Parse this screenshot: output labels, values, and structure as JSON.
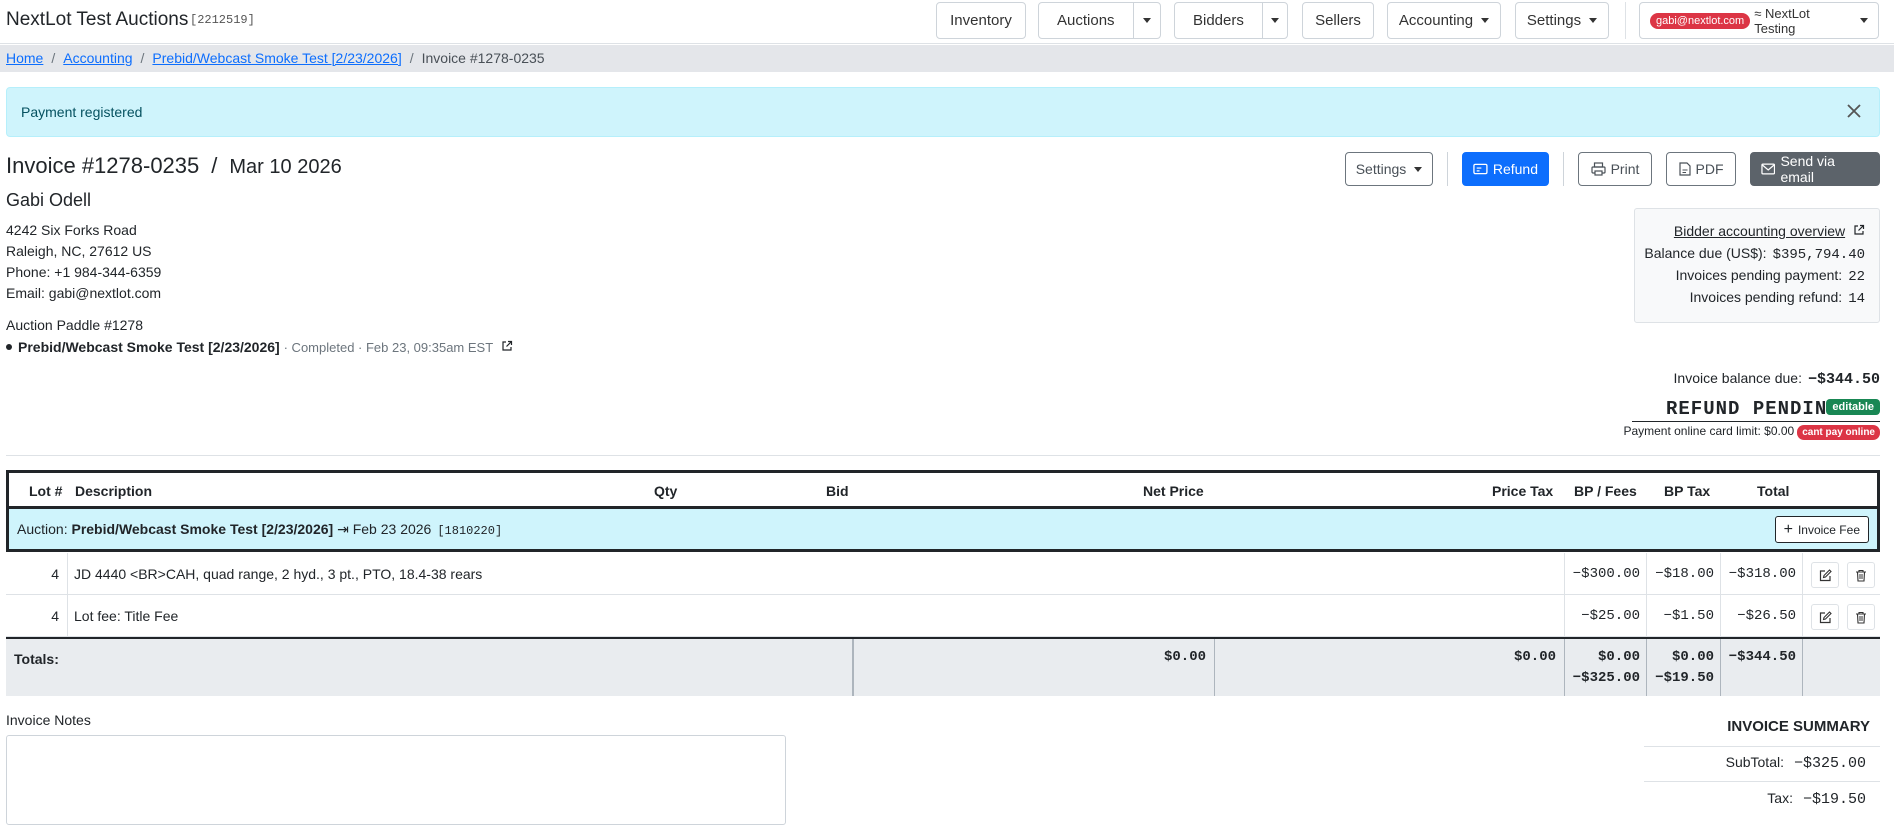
{
  "app": {
    "brand": "NextLot Test Auctions",
    "brand_id": "[2212519]"
  },
  "nav": {
    "inventory": "Inventory",
    "auctions": "Auctions",
    "bidders": "Bidders",
    "sellers": "Sellers",
    "accounting": "Accounting",
    "settings": "Settings",
    "user_email": "gabi@nextlot.com",
    "user_org": "≈ NextLot Testing"
  },
  "breadcrumb": {
    "home": "Home",
    "accounting": "Accounting",
    "auction": "Prebid/Webcast Smoke Test [2/23/2026]",
    "current": "Invoice #1278-0235"
  },
  "alert": {
    "message": "Payment registered"
  },
  "invoice": {
    "number": "Invoice #1278-0235",
    "divider": "/",
    "date": "Mar 10 2026",
    "actions": {
      "settings": "Settings",
      "refund": "Refund",
      "print": "Print",
      "pdf": "PDF",
      "email": "Send via email"
    }
  },
  "bidder": {
    "name": "Gabi Odell",
    "address1": "4242 Six Forks Road",
    "address2": "Raleigh, NC, 27612 US",
    "phone": "Phone: +1 984-344-6359",
    "email": "Email: gabi@nextlot.com",
    "paddle": "Auction Paddle #1278",
    "auction_name": "Prebid/Webcast Smoke Test [2/23/2026]",
    "auction_meta": "· Completed · Feb 23, 09:35am EST"
  },
  "account_card": {
    "overview_link": "Bidder accounting overview",
    "balance_label": "Balance due (US$):",
    "balance_value": "$395,794.40",
    "pending_payment_label": "Invoices pending payment:",
    "pending_payment_value": "22",
    "pending_refund_label": "Invoices pending refund:",
    "pending_refund_value": "14"
  },
  "status": {
    "balance_label": "Invoice balance due:",
    "balance_value": "−$344.50",
    "state": "REFUND PENDING",
    "editable_badge": "editable",
    "card_limit": "Payment online card limit: $0.00",
    "cant_pay_badge": "cant pay online",
    "colors": {
      "editable": "#198754",
      "cant_pay": "#dc3545",
      "refund_button": "#0d6efd",
      "group_bg": "#cff4fc"
    }
  },
  "table": {
    "headers": {
      "lot": "Lot #",
      "description": "Description",
      "qty": "Qty",
      "bid": "Bid",
      "net_price": "Net Price",
      "price_tax": "Price Tax",
      "bp_fees": "BP / Fees",
      "bp_tax": "BP Tax",
      "total": "Total"
    },
    "group": {
      "prefix": "Auction:",
      "name": "Prebid/Webcast Smoke Test [2/23/2026]",
      "date": "⇥ Feb 23 2026",
      "id": "[1810220]",
      "add_fee": "Invoice Fee"
    },
    "rows": [
      {
        "lot": "4",
        "description": "JD 4440 <BR>CAH, quad range, 2 hyd., 3 pt., PTO, 18.4-38 rears",
        "bp_fees": "−$300.00",
        "bp_tax": "−$18.00",
        "total": "−$318.00"
      },
      {
        "lot": "4",
        "description": "Lot fee: Title Fee",
        "bp_fees": "−$25.00",
        "bp_tax": "−$1.50",
        "total": "−$26.50"
      }
    ],
    "totals": {
      "label": "Totals:",
      "net_price": "$0.00",
      "price_tax": "$0.00",
      "bp_fees_1": "$0.00",
      "bp_fees_2": "−$325.00",
      "bp_tax_1": "$0.00",
      "bp_tax_2": "−$19.50",
      "total": "−$344.50"
    }
  },
  "notes": {
    "label": "Invoice Notes",
    "value": ""
  },
  "summary": {
    "title": "INVOICE SUMMARY",
    "subtotal_label": "SubTotal:",
    "subtotal_value": "−$325.00",
    "tax_label": "Tax:",
    "tax_value": "−$19.50"
  }
}
